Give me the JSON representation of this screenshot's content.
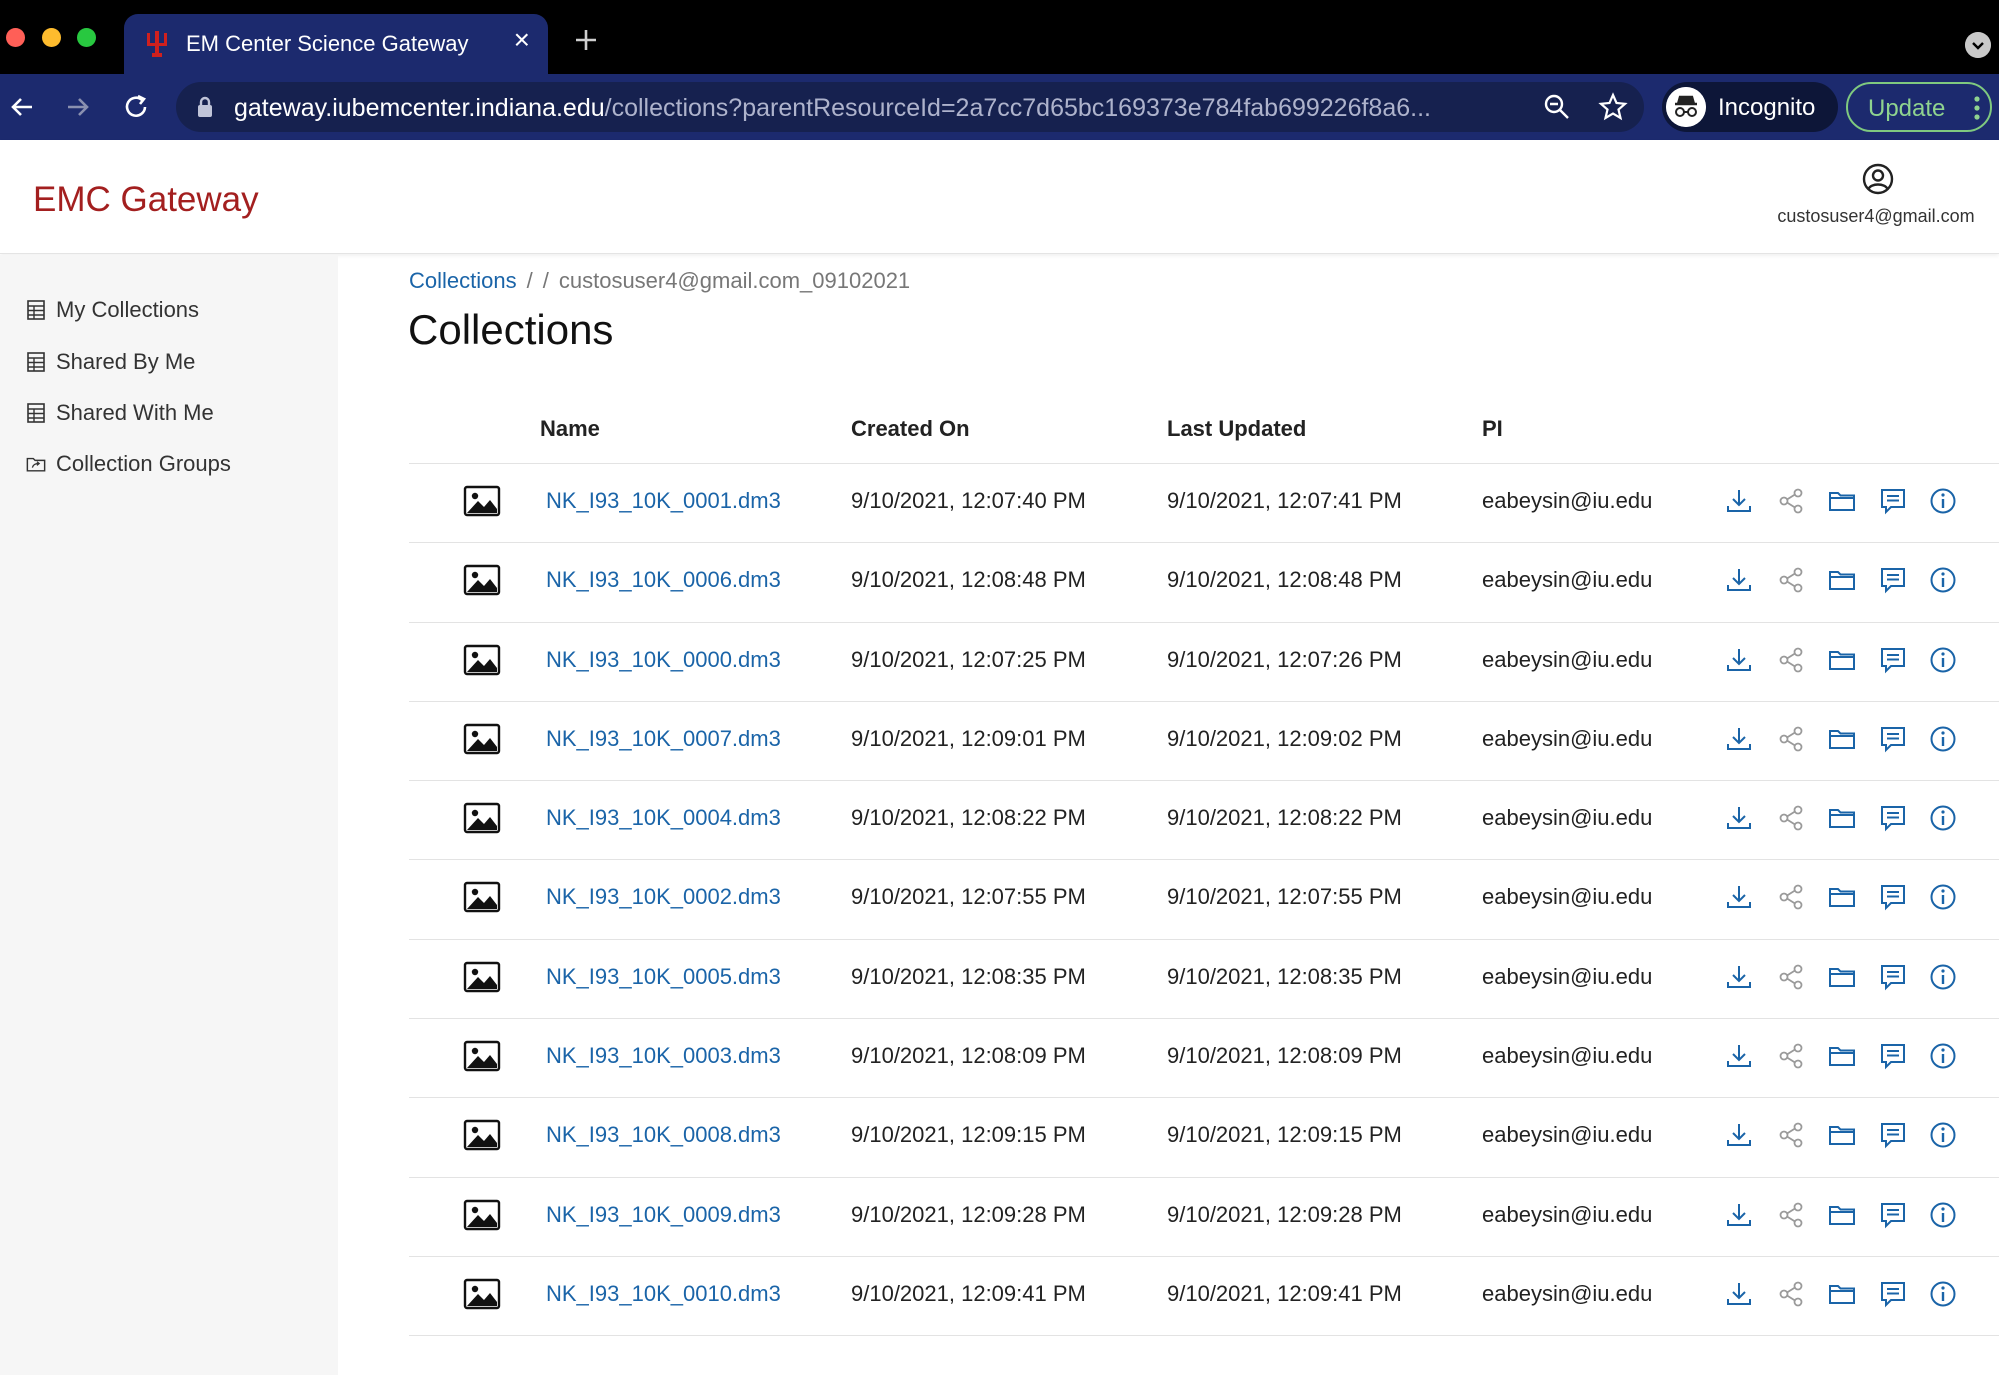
{
  "browser": {
    "tab_title": "EM Center Science Gateway",
    "tab_close": "×",
    "url_host": "gateway.iubemcenter.indiana.edu",
    "url_path": "/collections?parentResourceId=2a7cc7d65bc169373e784fab699226f8a6...",
    "incognito_label": "Incognito",
    "update_label": "Update"
  },
  "header": {
    "brand": "EMC Gateway",
    "user_email": "custosuser4@gmail.com"
  },
  "sidebar": {
    "items": [
      {
        "label": "My Collections",
        "icon": "table-icon"
      },
      {
        "label": "Shared By Me",
        "icon": "table-icon"
      },
      {
        "label": "Shared With Me",
        "icon": "table-icon"
      },
      {
        "label": "Collection Groups",
        "icon": "folder-share-icon"
      }
    ]
  },
  "breadcrumb": {
    "root": "Collections",
    "sep": "/",
    "current": "custosuser4@gmail.com_09102021"
  },
  "page": {
    "title": "Collections"
  },
  "table": {
    "headers": {
      "name": "Name",
      "created": "Created On",
      "updated": "Last Updated",
      "pi": "PI"
    },
    "rows": [
      {
        "name": "NK_I93_10K_0001.dm3",
        "created": "9/10/2021, 12:07:40 PM",
        "updated": "9/10/2021, 12:07:41 PM",
        "pi": "eabeysin@iu.edu"
      },
      {
        "name": "NK_I93_10K_0006.dm3",
        "created": "9/10/2021, 12:08:48 PM",
        "updated": "9/10/2021, 12:08:48 PM",
        "pi": "eabeysin@iu.edu"
      },
      {
        "name": "NK_I93_10K_0000.dm3",
        "created": "9/10/2021, 12:07:25 PM",
        "updated": "9/10/2021, 12:07:26 PM",
        "pi": "eabeysin@iu.edu"
      },
      {
        "name": "NK_I93_10K_0007.dm3",
        "created": "9/10/2021, 12:09:01 PM",
        "updated": "9/10/2021, 12:09:02 PM",
        "pi": "eabeysin@iu.edu"
      },
      {
        "name": "NK_I93_10K_0004.dm3",
        "created": "9/10/2021, 12:08:22 PM",
        "updated": "9/10/2021, 12:08:22 PM",
        "pi": "eabeysin@iu.edu"
      },
      {
        "name": "NK_I93_10K_0002.dm3",
        "created": "9/10/2021, 12:07:55 PM",
        "updated": "9/10/2021, 12:07:55 PM",
        "pi": "eabeysin@iu.edu"
      },
      {
        "name": "NK_I93_10K_0005.dm3",
        "created": "9/10/2021, 12:08:35 PM",
        "updated": "9/10/2021, 12:08:35 PM",
        "pi": "eabeysin@iu.edu"
      },
      {
        "name": "NK_I93_10K_0003.dm3",
        "created": "9/10/2021, 12:08:09 PM",
        "updated": "9/10/2021, 12:08:09 PM",
        "pi": "eabeysin@iu.edu"
      },
      {
        "name": "NK_I93_10K_0008.dm3",
        "created": "9/10/2021, 12:09:15 PM",
        "updated": "9/10/2021, 12:09:15 PM",
        "pi": "eabeysin@iu.edu"
      },
      {
        "name": "NK_I93_10K_0009.dm3",
        "created": "9/10/2021, 12:09:28 PM",
        "updated": "9/10/2021, 12:09:28 PM",
        "pi": "eabeysin@iu.edu"
      },
      {
        "name": "NK_I93_10K_0010.dm3",
        "created": "9/10/2021, 12:09:41 PM",
        "updated": "9/10/2021, 12:09:41 PM",
        "pi": "eabeysin@iu.edu"
      }
    ],
    "row_actions": [
      "download-icon",
      "share-icon",
      "folder-icon",
      "comment-icon",
      "info-icon"
    ]
  },
  "colors": {
    "tab_bg": "#1c2a6e",
    "brand": "#a31f1f",
    "link": "#1a64a8",
    "action_icon": "#1a64a8",
    "share_icon": "#9a9a9a"
  }
}
